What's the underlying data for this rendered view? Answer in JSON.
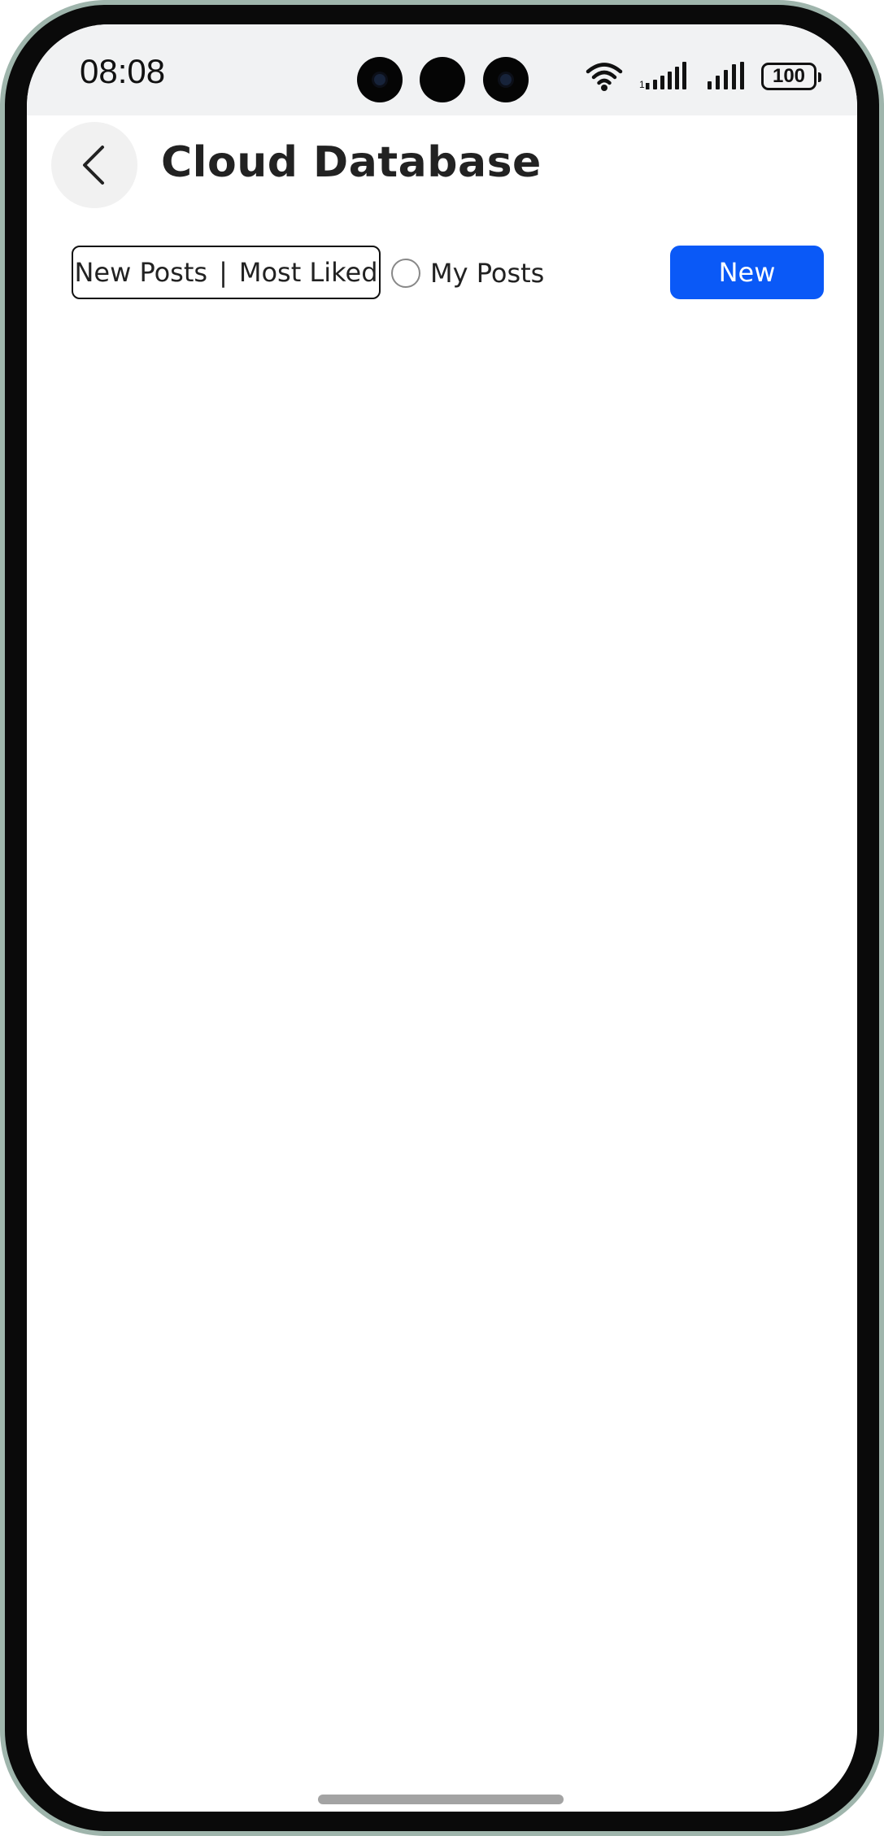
{
  "status_bar": {
    "time": "08:08",
    "battery": "100",
    "icons": [
      "wifi-icon",
      "signal-icon-1",
      "signal-icon-2",
      "battery-icon"
    ]
  },
  "header": {
    "back_icon": "chevron-left-icon",
    "title": "Cloud Database"
  },
  "toolbar": {
    "sort_new": "New Posts",
    "sort_separator": "|",
    "sort_liked": "Most Liked",
    "my_posts_label": "My Posts",
    "my_posts_checked": false,
    "new_button_label": "New"
  },
  "colors": {
    "accent": "#0a59f7",
    "status_bar_bg": "#f1f2f3",
    "back_button_bg": "#f1f1f1"
  }
}
